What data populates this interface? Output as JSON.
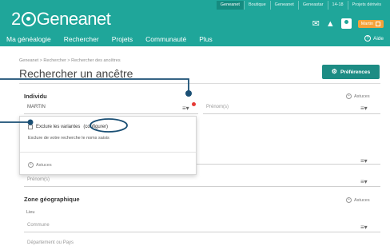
{
  "header": {
    "top_links": [
      "Geneanet",
      "Boutique",
      "Geneanet",
      "Geneastar",
      "14-18",
      "Projets dérivés"
    ],
    "active_top_link": 0,
    "logo": {
      "prefix": "2",
      "suffix": "Geneanet"
    },
    "icons": [
      "mail-icon",
      "bell-icon",
      "avatar-icon"
    ],
    "user_badge": "Martin",
    "nav": [
      "Ma généalogie",
      "Rechercher",
      "Projets",
      "Communauté",
      "Plus"
    ],
    "help": "Aide",
    "color_brand": "#1fa69a"
  },
  "page": {
    "breadcrumb": "Geneanet > Rechercher > Rechercher des ancêtres",
    "title": "Rechercher un ancêtre",
    "preferences_button": "Préférences",
    "button_color": "#1d8c84"
  },
  "individu": {
    "title": "Individu",
    "aide": "Astuces",
    "nom_value": "MARTIN",
    "prenoms_placeholder": "Prénom(s)",
    "popup": {
      "checkbox_label": "Exclure les variantes",
      "configurer": "(configurer)",
      "description": "Exclure de votre recherche le noms saisis",
      "astuces": "Astuces"
    },
    "second_prenoms_placeholder": "Prénom(s)"
  },
  "zone": {
    "title": "Zone géographique",
    "aide": "Astuces",
    "lieu_label": "Lieu",
    "commune_placeholder": "Commune",
    "departement_placeholder": "Département ou Pays"
  },
  "annotation_color": "#1a4f74",
  "notification_color": "#e53935"
}
